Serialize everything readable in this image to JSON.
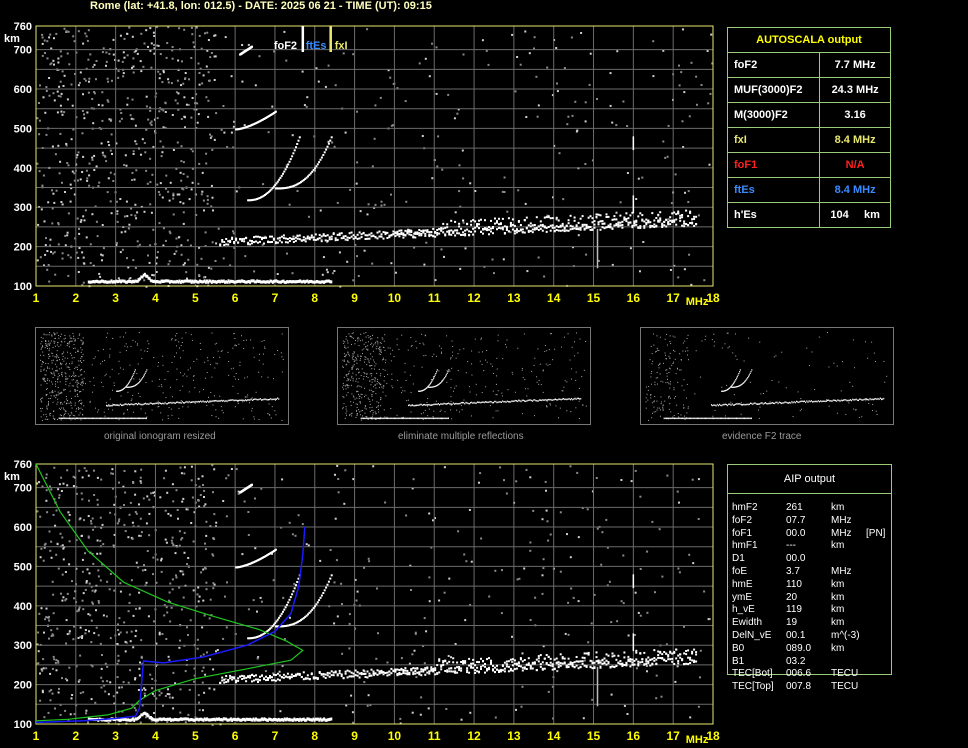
{
  "window_title": "Rome (lat: +41.8, lon: 012.5) - DATE: 2025 06 21 - TIME (UT): 09:15",
  "top_chart": {
    "y_ticks": [
      "760",
      "700",
      "600",
      "500",
      "400",
      "300",
      "200",
      "100"
    ],
    "y_unit": "km",
    "x_ticks": [
      "1",
      "2",
      "3",
      "4",
      "5",
      "6",
      "7",
      "8",
      "9",
      "10",
      "11",
      "12",
      "13",
      "14",
      "15",
      "16",
      "17",
      "18"
    ],
    "x_unit": "MHz",
    "markers": {
      "foF2": "foF2",
      "ftEs": "ftEs",
      "fxI": "fxI"
    }
  },
  "autoscala": {
    "header": "AUTOSCALA output",
    "rows": [
      {
        "label": "foF2",
        "value": "7.7 MHz",
        "color": "#ffffff"
      },
      {
        "label": "MUF(3000)F2",
        "value": "24.3 MHz",
        "color": "#ffffff"
      },
      {
        "label": "M(3000)F2",
        "value": "3.16",
        "color": "#ffffff"
      },
      {
        "label": "fxI",
        "value": "8.4 MHz",
        "color": "#e8e870"
      },
      {
        "label": "foF1",
        "value": "N/A",
        "color": "#ff2020"
      },
      {
        "label": "ftEs",
        "value": "8.4 MHz",
        "color": "#3a8cff"
      },
      {
        "label": "h'Es",
        "value": "104     km",
        "color": "#ffffff"
      }
    ]
  },
  "thumbnails": [
    {
      "caption": "original ionogram resized"
    },
    {
      "caption": "eliminate multiple reflections"
    },
    {
      "caption": "evidence F2 trace"
    }
  ],
  "bottom_chart": {
    "y_ticks": [
      "760",
      "700",
      "600",
      "500",
      "400",
      "300",
      "200",
      "100"
    ],
    "y_unit": "km",
    "x_ticks": [
      "1",
      "2",
      "3",
      "4",
      "5",
      "6",
      "7",
      "8",
      "9",
      "10",
      "11",
      "12",
      "13",
      "14",
      "15",
      "16",
      "17",
      "18"
    ],
    "x_unit": "MHz"
  },
  "aip": {
    "header": "AIP output",
    "rows": [
      {
        "k": "hmF2",
        "v": "261",
        "u": "km",
        "x": ""
      },
      {
        "k": "foF2",
        "v": "07.7",
        "u": "MHz",
        "x": ""
      },
      {
        "k": "foF1",
        "v": "00.0",
        "u": "MHz",
        "x": "[PN]"
      },
      {
        "k": "hmF1",
        "v": "---",
        "u": "km",
        "x": ""
      },
      {
        "k": "D1",
        "v": "00.0",
        "u": "",
        "x": ""
      },
      {
        "k": "foE",
        "v": "3.7",
        "u": "MHz",
        "x": ""
      },
      {
        "k": "hmE",
        "v": "110",
        "u": "km",
        "x": ""
      },
      {
        "k": "ymE",
        "v": "20",
        "u": "km",
        "x": ""
      },
      {
        "k": "h_vE",
        "v": "119",
        "u": "km",
        "x": ""
      },
      {
        "k": "Ewidth",
        "v": "19",
        "u": "km",
        "x": ""
      },
      {
        "k": "DelN_vE",
        "v": "00.1",
        "u": "m^(-3)",
        "x": ""
      },
      {
        "k": "B0",
        "v": "089.0",
        "u": "km",
        "x": ""
      },
      {
        "k": "B1",
        "v": "03.2",
        "u": "",
        "x": ""
      },
      {
        "k": "TEC[Bot]",
        "v": "006.6",
        "u": "TECU",
        "x": ""
      },
      {
        "k": "TEC[Top]",
        "v": "007.8",
        "u": "TECU",
        "x": ""
      }
    ]
  },
  "colors": {
    "grid": "#6b6b6b",
    "frame": "#e8e870",
    "axis_text": "#ffff00",
    "table_border": "#9acd7a",
    "trace": "#ffffff",
    "profile_green": "#1ec81e",
    "profile_blue": "#1a1aff"
  }
}
